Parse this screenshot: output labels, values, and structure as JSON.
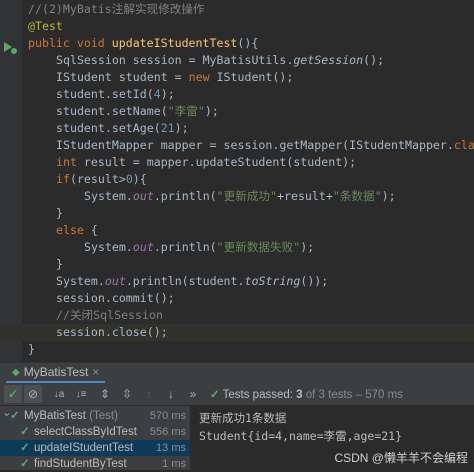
{
  "editor": {
    "lines": [
      {
        "indent": 4,
        "parts": [
          {
            "t": "//(2)MyBatis注解实现修改操作",
            "c": "cm"
          }
        ]
      },
      {
        "indent": 4,
        "parts": [
          {
            "t": "@Test",
            "c": "ann"
          }
        ]
      },
      {
        "indent": 4,
        "parts": [
          {
            "t": "public void ",
            "c": "kw"
          },
          {
            "t": "updateIStudentTest",
            "c": "fn"
          },
          {
            "t": "(){",
            "c": ""
          }
        ]
      },
      {
        "indent": 8,
        "parts": [
          {
            "t": "SqlSession session = MyBatisUtils.",
            "c": ""
          },
          {
            "t": "getSession",
            "c": "itf"
          },
          {
            "t": "();",
            "c": ""
          }
        ]
      },
      {
        "indent": 8,
        "parts": [
          {
            "t": "IStudent student = ",
            "c": ""
          },
          {
            "t": "new ",
            "c": "kw"
          },
          {
            "t": "IStudent();",
            "c": ""
          }
        ]
      },
      {
        "indent": 8,
        "parts": [
          {
            "t": "student.setId(",
            "c": ""
          },
          {
            "t": "4",
            "c": "num"
          },
          {
            "t": ");",
            "c": ""
          }
        ]
      },
      {
        "indent": 8,
        "parts": [
          {
            "t": "student.setName(",
            "c": ""
          },
          {
            "t": "\"李雷\"",
            "c": "str"
          },
          {
            "t": ");",
            "c": ""
          }
        ]
      },
      {
        "indent": 8,
        "parts": [
          {
            "t": "student.setAge(",
            "c": ""
          },
          {
            "t": "21",
            "c": "num"
          },
          {
            "t": ");",
            "c": ""
          }
        ]
      },
      {
        "indent": 8,
        "parts": [
          {
            "t": "IStudentMapper mapper = session.getMapper(IStudentMapper.",
            "c": ""
          },
          {
            "t": "class",
            "c": "kw"
          },
          {
            "t": ");",
            "c": ""
          }
        ]
      },
      {
        "indent": 8,
        "parts": [
          {
            "t": "int ",
            "c": "kw"
          },
          {
            "t": "result = mapper.updateStudent(student);",
            "c": ""
          }
        ]
      },
      {
        "indent": 8,
        "parts": [
          {
            "t": "if",
            "c": "kw"
          },
          {
            "t": "(result>",
            "c": ""
          },
          {
            "t": "0",
            "c": "num"
          },
          {
            "t": "){",
            "c": ""
          }
        ]
      },
      {
        "indent": 12,
        "parts": [
          {
            "t": "System.",
            "c": ""
          },
          {
            "t": "out",
            "c": "it"
          },
          {
            "t": ".println(",
            "c": ""
          },
          {
            "t": "\"更新成功\"",
            "c": "str"
          },
          {
            "t": "+result+",
            "c": ""
          },
          {
            "t": "\"条数据\"",
            "c": "str"
          },
          {
            "t": ");",
            "c": ""
          }
        ]
      },
      {
        "indent": 8,
        "parts": [
          {
            "t": "}",
            "c": ""
          }
        ]
      },
      {
        "indent": 8,
        "parts": [
          {
            "t": "else ",
            "c": "kw"
          },
          {
            "t": "{",
            "c": ""
          }
        ]
      },
      {
        "indent": 12,
        "parts": [
          {
            "t": "System.",
            "c": ""
          },
          {
            "t": "out",
            "c": "it"
          },
          {
            "t": ".println(",
            "c": ""
          },
          {
            "t": "\"更新数据失败\"",
            "c": "str"
          },
          {
            "t": ");",
            "c": ""
          }
        ]
      },
      {
        "indent": 8,
        "parts": [
          {
            "t": "}",
            "c": ""
          }
        ]
      },
      {
        "indent": 8,
        "parts": [
          {
            "t": "System.",
            "c": ""
          },
          {
            "t": "out",
            "c": "it"
          },
          {
            "t": ".println(student.",
            "c": ""
          },
          {
            "t": "toString",
            "c": "itf"
          },
          {
            "t": "());",
            "c": ""
          }
        ]
      },
      {
        "indent": 8,
        "parts": [
          {
            "t": "session.commit();",
            "c": ""
          }
        ]
      },
      {
        "indent": 8,
        "parts": [
          {
            "t": "//关闭SqlSession",
            "c": "cm"
          }
        ]
      },
      {
        "indent": 8,
        "parts": [
          {
            "t": "session.close();",
            "c": ""
          }
        ],
        "highlight": true
      },
      {
        "indent": 4,
        "parts": [
          {
            "t": "}",
            "c": ""
          }
        ]
      }
    ]
  },
  "run_panel": {
    "tab_label": "MyBatisTest",
    "tab_close": "×",
    "status_prefix": "Tests passed: ",
    "status_count": "3",
    "status_suffix": " of 3 tests – 570 ms"
  },
  "tree": [
    {
      "label": "MyBatisTest",
      "sub": " (Test)",
      "duration": "570 ms",
      "level": 0,
      "selected": false
    },
    {
      "label": "selectClassByIdTest",
      "sub": "",
      "duration": "556 ms",
      "level": 1,
      "selected": false
    },
    {
      "label": "updateIStudentTest",
      "sub": "",
      "duration": "13 ms",
      "level": 1,
      "selected": true
    },
    {
      "label": "findStudentByTest",
      "sub": "",
      "duration": "1 ms",
      "level": 1,
      "selected": false
    }
  ],
  "console": {
    "lines": [
      "更新成功1条数据",
      "Student{id=4,name=李雷,age=21}"
    ]
  },
  "watermark": "CSDN @懒羊羊不会编程",
  "colors": {
    "accent": "#4a88c7",
    "pass": "#59a869",
    "selection": "#0d3a58"
  }
}
